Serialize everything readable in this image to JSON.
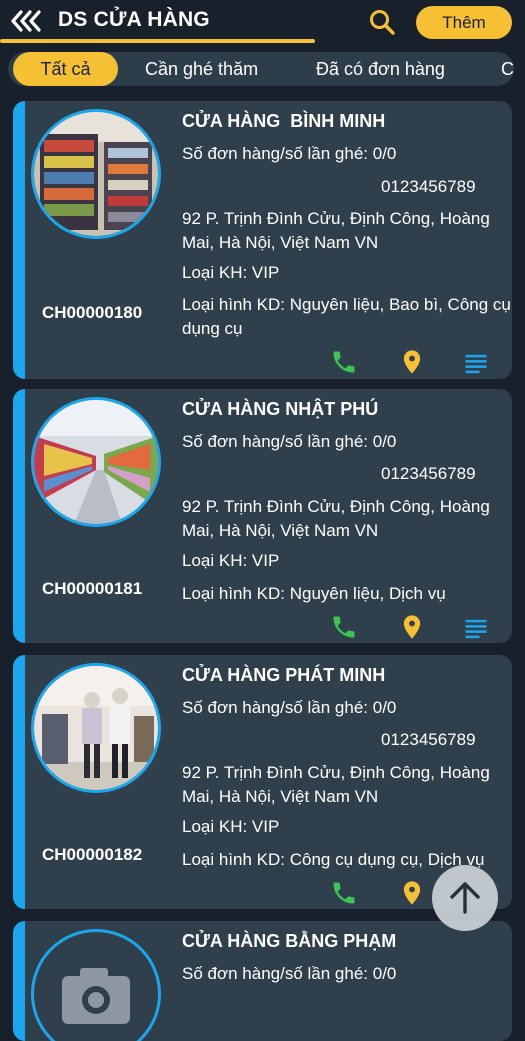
{
  "header": {
    "title": "DS CỬA HÀNG",
    "add_label": "Thêm",
    "accent_color": "#f5c033"
  },
  "tabs": [
    {
      "label": "Tất cả",
      "active": true
    },
    {
      "label": "Cần ghé thăm",
      "active": false
    },
    {
      "label": "Đã có đơn hàng",
      "active": false
    },
    {
      "label": "C",
      "active": false
    }
  ],
  "stores": [
    {
      "name": "CỬA HÀNG  BÌNH MINH",
      "visits": "Số đơn hàng/số lần ghé:  0/0",
      "phone": "0123456789",
      "address": "92 P. Trịnh Đình Cửu, Định Công, Hoàng Mai, Hà Nội, Việt Nam  VN",
      "customer_type": "Loại KH: VIP",
      "business_type": "Loại hình KD: Nguyên liệu, Bao bì, Công cụ dụng cụ",
      "code": "CH00000180",
      "image": "store-shelves-photo"
    },
    {
      "name": "CỬA HÀNG NHẬT PHÚ",
      "visits": "Số đơn hàng/số lần ghé:  0/0",
      "phone": "0123456789",
      "address": "92 P. Trịnh Đình Cửu, Định Công, Hoàng Mai, Hà Nội, Việt Nam  VN",
      "customer_type": "Loại KH: VIP",
      "business_type": "Loại hình KD: Nguyên liệu, Dịch vụ",
      "code": "CH00000181",
      "image": "supermarket-aisle-photo"
    },
    {
      "name": "CỬA HÀNG PHÁT MINH",
      "visits": "Số đơn hàng/số lần ghé:  0/0",
      "phone": "0123456789",
      "address": "92 P. Trịnh Đình Cửu, Định Công, Hoàng Mai, Hà Nội, Việt Nam  VN",
      "customer_type": "Loại KH: VIP",
      "business_type": "Loại hình KD: Công cụ dụng cụ, Dịch vụ",
      "code": "CH00000182",
      "image": "clothing-store-photo"
    },
    {
      "name": "CỬA HÀNG BẰNG PHẠM",
      "visits": "Số đơn hàng/số lần ghé:  0/0",
      "image": "camera-placeholder-icon"
    }
  ],
  "icons": {
    "back": "double-chevron-left-icon",
    "search": "search-icon",
    "call": "phone-icon",
    "location": "map-pin-icon",
    "details": "list-lines-icon",
    "scroll_top": "arrow-up-icon"
  },
  "colors": {
    "background": "#17202b",
    "card": "#2f3f4c",
    "card_accent": "#1aa7ee",
    "call_icon": "#3cc651",
    "location_icon": "#f5c033",
    "details_icon": "#1aa7ee"
  }
}
